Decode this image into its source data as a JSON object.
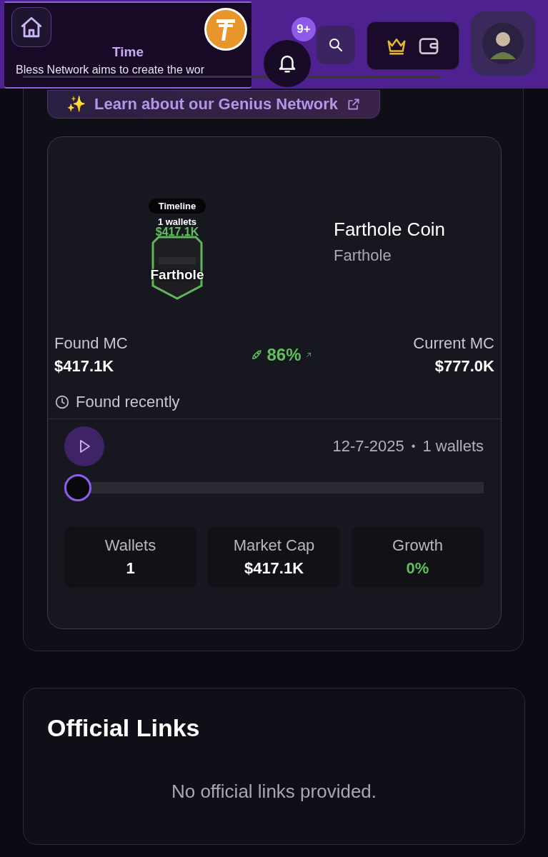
{
  "header": {
    "ticker": {
      "title": "Time",
      "text": "Bless Network aims to create the wor"
    },
    "notifications": {
      "badge": "9+"
    }
  },
  "learn_link": {
    "icon": "✨",
    "label": "Learn about our Genius Network"
  },
  "coin": {
    "badge": {
      "pill": "Timeline",
      "wallets": "1 wallets",
      "value": "$417.1K",
      "name": "Farthole"
    },
    "name": "Farthole Coin",
    "symbol": "Farthole",
    "found_mc": {
      "label": "Found MC",
      "value": "$417.1K"
    },
    "growth": "86%",
    "current_mc": {
      "label": "Current MC",
      "value": "$777.0K"
    },
    "found_time": "Found recently"
  },
  "timeline": {
    "date": "12-7-2025",
    "separator": "•",
    "wallets": "1 wallets",
    "slider": {
      "level": 0
    },
    "stats": [
      {
        "label": "Wallets",
        "value": "1",
        "kind": "plain"
      },
      {
        "label": "Market Cap",
        "value": "$417.1K",
        "kind": "plain"
      },
      {
        "label": "Growth",
        "value": "0%",
        "kind": "positive"
      }
    ]
  },
  "official_links": {
    "title": "Official Links",
    "empty": "No official links provided."
  }
}
